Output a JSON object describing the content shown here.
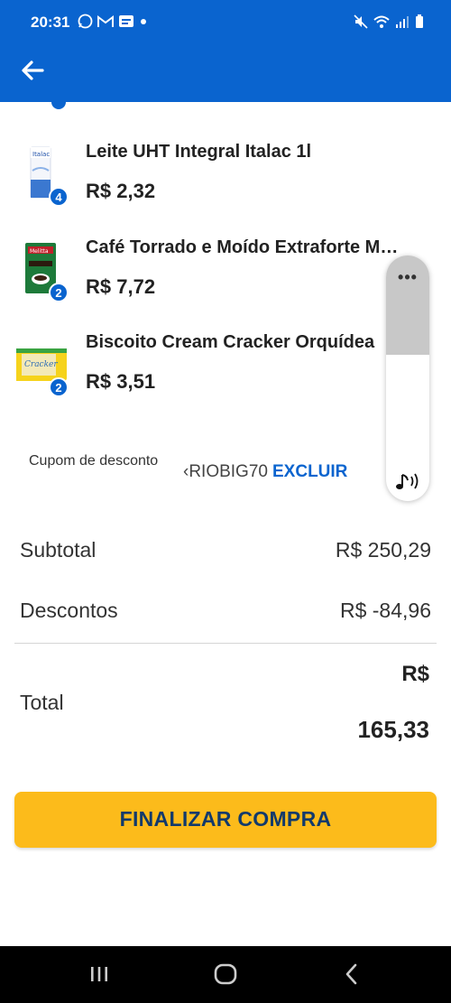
{
  "status_bar": {
    "time": "20:31",
    "left_icons": [
      "whatsapp-icon",
      "gmail-icon",
      "news-icon",
      "dot-icon"
    ],
    "right_icons": [
      "mute-icon",
      "wifi-icon",
      "signal-icon",
      "battery-icon"
    ]
  },
  "header": {
    "back_icon": "arrow-left-icon",
    "color": "#0a64cf"
  },
  "products": [
    {
      "name": "Leite UHT Integral Italac 1l",
      "price": "R$ 2,32",
      "quantity": "4"
    },
    {
      "name": "Café Torrado e Moído Extraforte Melitta",
      "price": "R$ 7,72",
      "quantity": "2"
    },
    {
      "name": "Biscoito Cream Cracker Orquídea",
      "price": "R$ 3,51",
      "quantity": "2"
    }
  ],
  "coupon": {
    "label": "Cupom de desconto",
    "code": "‹RIOBIG70",
    "remove_label": "EXCLUIR"
  },
  "overlay": {
    "menu_label": "•••",
    "sound_icon": "music-sound-icon"
  },
  "summary": {
    "subtotal_label": "Subtotal",
    "subtotal_value": "R$ 250,29",
    "discount_label": "Descontos",
    "discount_value": "R$ -84,96",
    "total_label": "Total",
    "total_currency": "R$",
    "total_value": "165,33"
  },
  "checkout": {
    "label": "FINALIZAR COMPRA",
    "color": "#fcbb1b"
  },
  "nav_bar": {
    "icons": [
      "recent-apps-icon",
      "home-icon",
      "back-icon"
    ]
  }
}
